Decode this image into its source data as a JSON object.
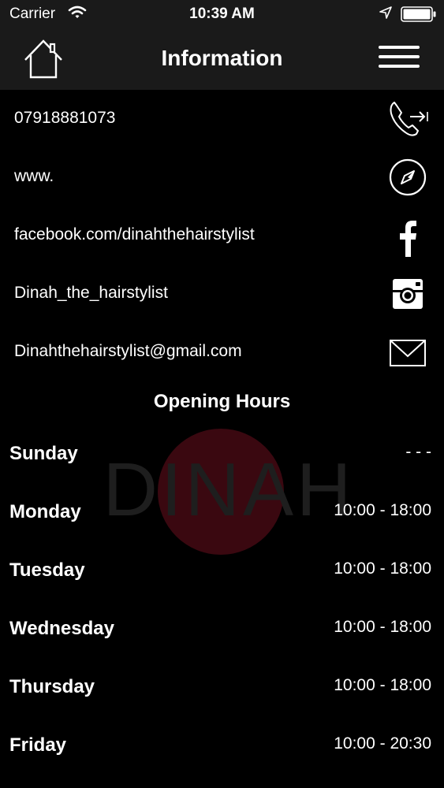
{
  "status_bar": {
    "carrier": "Carrier",
    "time": "10:39 AM"
  },
  "nav": {
    "title": "Information",
    "home_icon": "home-icon",
    "menu_icon": "hamburger-menu-icon"
  },
  "contacts": [
    {
      "label": "07918881073",
      "icon": "phone-icon"
    },
    {
      "label": "www.",
      "icon": "compass-icon"
    },
    {
      "label": "facebook.com/dinahthehairstylist",
      "icon": "facebook-icon"
    },
    {
      "label": "Dinah_the_hairstylist",
      "icon": "instagram-icon"
    },
    {
      "label": "Dinahthehairstylist@gmail.com",
      "icon": "mail-icon"
    }
  ],
  "opening_hours": {
    "title": "Opening Hours",
    "days": [
      {
        "day": "Sunday",
        "hours": "- - -"
      },
      {
        "day": "Monday",
        "hours": "10:00 - 18:00"
      },
      {
        "day": "Tuesday",
        "hours": "10:00 - 18:00"
      },
      {
        "day": "Wednesday",
        "hours": "10:00 - 18:00"
      },
      {
        "day": "Thursday",
        "hours": "10:00 - 18:00"
      },
      {
        "day": "Friday",
        "hours": "10:00 - 20:30"
      }
    ]
  },
  "watermark": {
    "text": "DINAH",
    "accent_color": "#3a0810"
  }
}
